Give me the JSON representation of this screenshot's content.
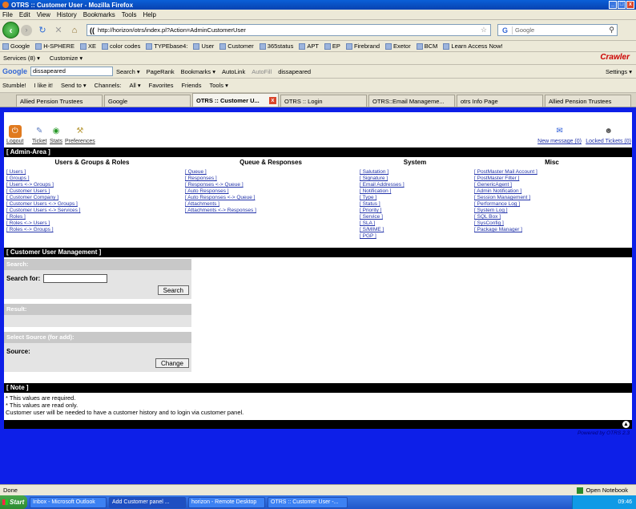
{
  "window": {
    "title": "OTRS :: Customer User - Mozilla Firefox",
    "min": "_",
    "max": "□",
    "close": "x"
  },
  "menu": [
    "File",
    "Edit",
    "View",
    "History",
    "Bookmarks",
    "Tools",
    "Help"
  ],
  "nav": {
    "url": "http://horizon/otrs/index.pl?Action=AdminCustomerUser",
    "search_placeholder": "Google"
  },
  "bookmarks": [
    "Google",
    "H-SPHERE",
    "XE",
    "color codes",
    "TYPEbase4:",
    "User",
    "Customer",
    "365status",
    "APT",
    "EP",
    "Firebrand",
    "Exetor",
    "BCM",
    "Learn Access Now!"
  ],
  "services": {
    "services": "Services (8) ▾",
    "customize": "Customize ▾",
    "crawler": "Crawler"
  },
  "google_toolbar": {
    "logo": "Google",
    "query": "dissapeared",
    "search": "Search ▾",
    "pagerank": "PageRank",
    "bookmarks": "Bookmarks ▾",
    "autolink": "AutoLink",
    "autofill": "AutoFill",
    "word": "dissapeared",
    "settings": "Settings ▾"
  },
  "stumble_toolbar": {
    "stumble": "Stumble!",
    "like": "I like it!",
    "sendto": "Send to ▾",
    "channels": "Channels:",
    "all": "All ▾",
    "favorites": "Favorites",
    "friends": "Friends",
    "tools": "Tools ▾"
  },
  "tabs": [
    "Allied Pension Trustees",
    "Google",
    "OTRS :: Customer U...",
    "OTRS :: Login",
    "OTRS::Email Manageme...",
    "otrs Info Page",
    "Allied Pension Trustees"
  ],
  "header": {
    "logout": "Logout",
    "ticket": "Ticket",
    "stats": "Stats",
    "preferences": "Preferences",
    "new_message": "New message (0)",
    "locked_tickets": "Locked Tickets (0)"
  },
  "admin_area": {
    "title": "[ Admin-Area ]",
    "columns": [
      {
        "heading": "Users & Groups & Roles",
        "links": [
          "[ Users ]",
          "[ Groups ]",
          "[ Users <-> Groups ]",
          "[ Customer Users ]",
          "[ Customer Company ]",
          "[ Customer Users <-> Groups ]",
          "[ Customer Users <-> Services ]",
          "[ Roles ]",
          "[ Roles <-> Users ]",
          "[ Roles <-> Groups ]"
        ]
      },
      {
        "heading": "Queue & Responses",
        "links": [
          "[ Queue ]",
          "[ Responses ]",
          "[ Responses <-> Queue ]",
          "[ Auto Responses ]",
          "[ Auto Responses <-> Queue ]",
          "[ Attachments ]",
          "[ Attachments <-> Responses ]"
        ]
      },
      {
        "heading": "System",
        "links": [
          "[ Salutation ]",
          "[ Signature ]",
          "[ Email Addresses ]",
          "[ Notification ]",
          "[ Type ]",
          "[ Status ]",
          "[ Priority ]",
          "[ Service ]",
          "[ SLA ]",
          "[ S/MIME ]",
          "[ PGP ]"
        ]
      },
      {
        "heading": "Misc",
        "links": [
          "[ PostMaster Mail Account ]",
          "[ PostMaster Filter ]",
          "[ GenericAgent ]",
          "[ Admin Notification ]",
          "[ Session Management ]",
          "[ Performance Log ]",
          "[ System Log ]",
          "[ SQL Box ]",
          "[ SysConfig ]",
          "[ Package Manager ]"
        ]
      }
    ]
  },
  "cum": {
    "title": "[ Customer User Management ]",
    "search_head": "Search:",
    "search_for": "Search for:",
    "search_value": "",
    "search_btn": "Search",
    "result_head": "Result:",
    "source_head": "Select Source (for add):",
    "source_label": "Source:",
    "change_btn": "Change"
  },
  "note": {
    "title": "[ Note ]",
    "lines": [
      "* This values are required.",
      "* This values are read only.",
      "Customer user will be needed to have a customer history and to login via customer panel."
    ]
  },
  "powered": "Powered by OTRS 2.3",
  "status": {
    "text": "Done",
    "onenote": "Open Notebook"
  },
  "taskbar": {
    "start": "Start",
    "items": [
      "Inbox - Microsoft Outlook",
      "Add Customer panel ...",
      "horizon - Remote Desktop",
      "OTRS :: Customer User -..."
    ],
    "clock": "09:46"
  }
}
